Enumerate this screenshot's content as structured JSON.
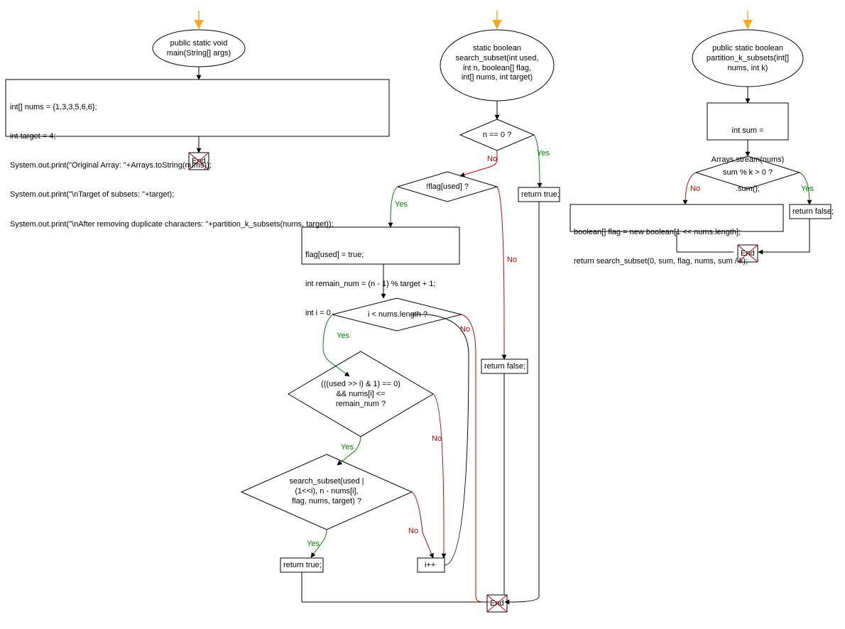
{
  "flowcharts": [
    {
      "id": "main",
      "start": {
        "label": "public static void\nmain(String[] args)"
      },
      "process_block": {
        "lines": [
          "int[] nums = {1,3,3,5,6,6};",
          "int target = 4;",
          "System.out.print(\"Original Array: \"+Arrays.toString(nums));",
          "System.out.print(\"\\nTarget of subsets: \"+target);",
          "System.out.print(\"\\nAfter removing duplicate characters: \"+partition_k_subsets(nums, target));"
        ]
      },
      "end": "End"
    },
    {
      "id": "search_subset",
      "start": {
        "label": "static boolean\nsearch_subset(int used,\nint n, boolean[] flag,\nint[] nums, int target)"
      },
      "decision_1": {
        "label": "n == 0 ?",
        "yes": "return true;",
        "no_goes_to": "decision_2"
      },
      "decision_2": {
        "label": "!flag[used] ?",
        "yes_goes_to": "process_1",
        "no": "return false;"
      },
      "process_1": {
        "lines": [
          "flag[used] = true;",
          "int remain_num = (n - 1) % target + 1;",
          "int i = 0"
        ]
      },
      "decision_loop": {
        "label": "i < nums.length ?",
        "no_goes_to": "end",
        "yes_goes_to": "decision_3"
      },
      "decision_3": {
        "label": "(((used >> i) & 1) == 0)\n&& nums[i] <=\nremain_num ?",
        "no_goes_to": "increment",
        "yes_goes_to": "decision_4"
      },
      "decision_4": {
        "label": "search_subset(used |\n(1<<i), n - nums[i],\nflag, nums, target) ?",
        "yes": "return true;",
        "no_goes_to": "increment"
      },
      "increment": "i++",
      "return_true_1": "return true;",
      "return_false": "return false;",
      "return_true_2": "return true;",
      "end": "End"
    },
    {
      "id": "partition_k_subsets",
      "start": {
        "label": "public static boolean\npartition_k_subsets(int[]\nnums, int k)"
      },
      "process_1": {
        "lines": [
          "int sum =",
          "Arrays.stream(nums)",
          ".sum();"
        ]
      },
      "decision_1": {
        "label": "sum % k > 0 ?",
        "yes": "return false;",
        "no_goes_to": "process_2"
      },
      "process_2": {
        "lines": [
          "boolean[] flag = new boolean[1 << nums.length];",
          "return search_subset(0, sum, flag, nums, sum / k);"
        ]
      },
      "return_false": "return false;",
      "end": "End"
    }
  ],
  "labels": {
    "yes": "Yes",
    "no": "No"
  }
}
